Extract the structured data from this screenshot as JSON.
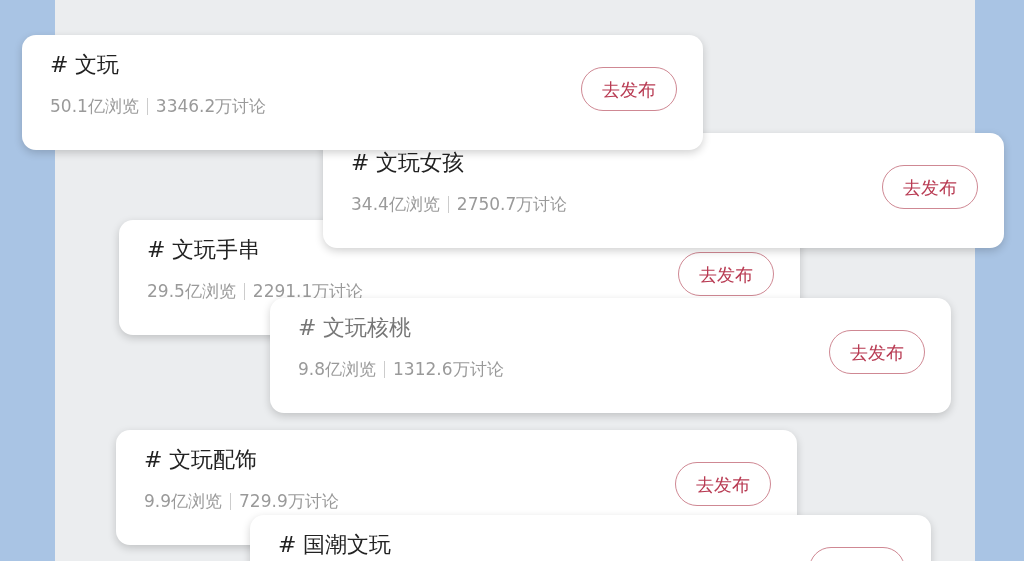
{
  "topics": [
    {
      "title": "# 文玩",
      "views": "50.1亿浏览",
      "discussions": "3346.2万讨论",
      "button": "去发布",
      "faded": false
    },
    {
      "title": "# 文玩女孩",
      "views": "34.4亿浏览",
      "discussions": "2750.7万讨论",
      "button": "去发布",
      "faded": false
    },
    {
      "title": "# 文玩手串",
      "views": "29.5亿浏览",
      "discussions": "2291.1万讨论",
      "button": "去发布",
      "faded": false
    },
    {
      "title": "# 文玩核桃",
      "views": "9.8亿浏览",
      "discussions": "1312.6万讨论",
      "button": "去发布",
      "faded": true
    },
    {
      "title": "# 文玩配饰",
      "views": "9.9亿浏览",
      "discussions": "729.9万讨论",
      "button": "去发布",
      "faded": false
    },
    {
      "title": "# 国潮文玩",
      "faded": false,
      "button_outline": true
    }
  ]
}
